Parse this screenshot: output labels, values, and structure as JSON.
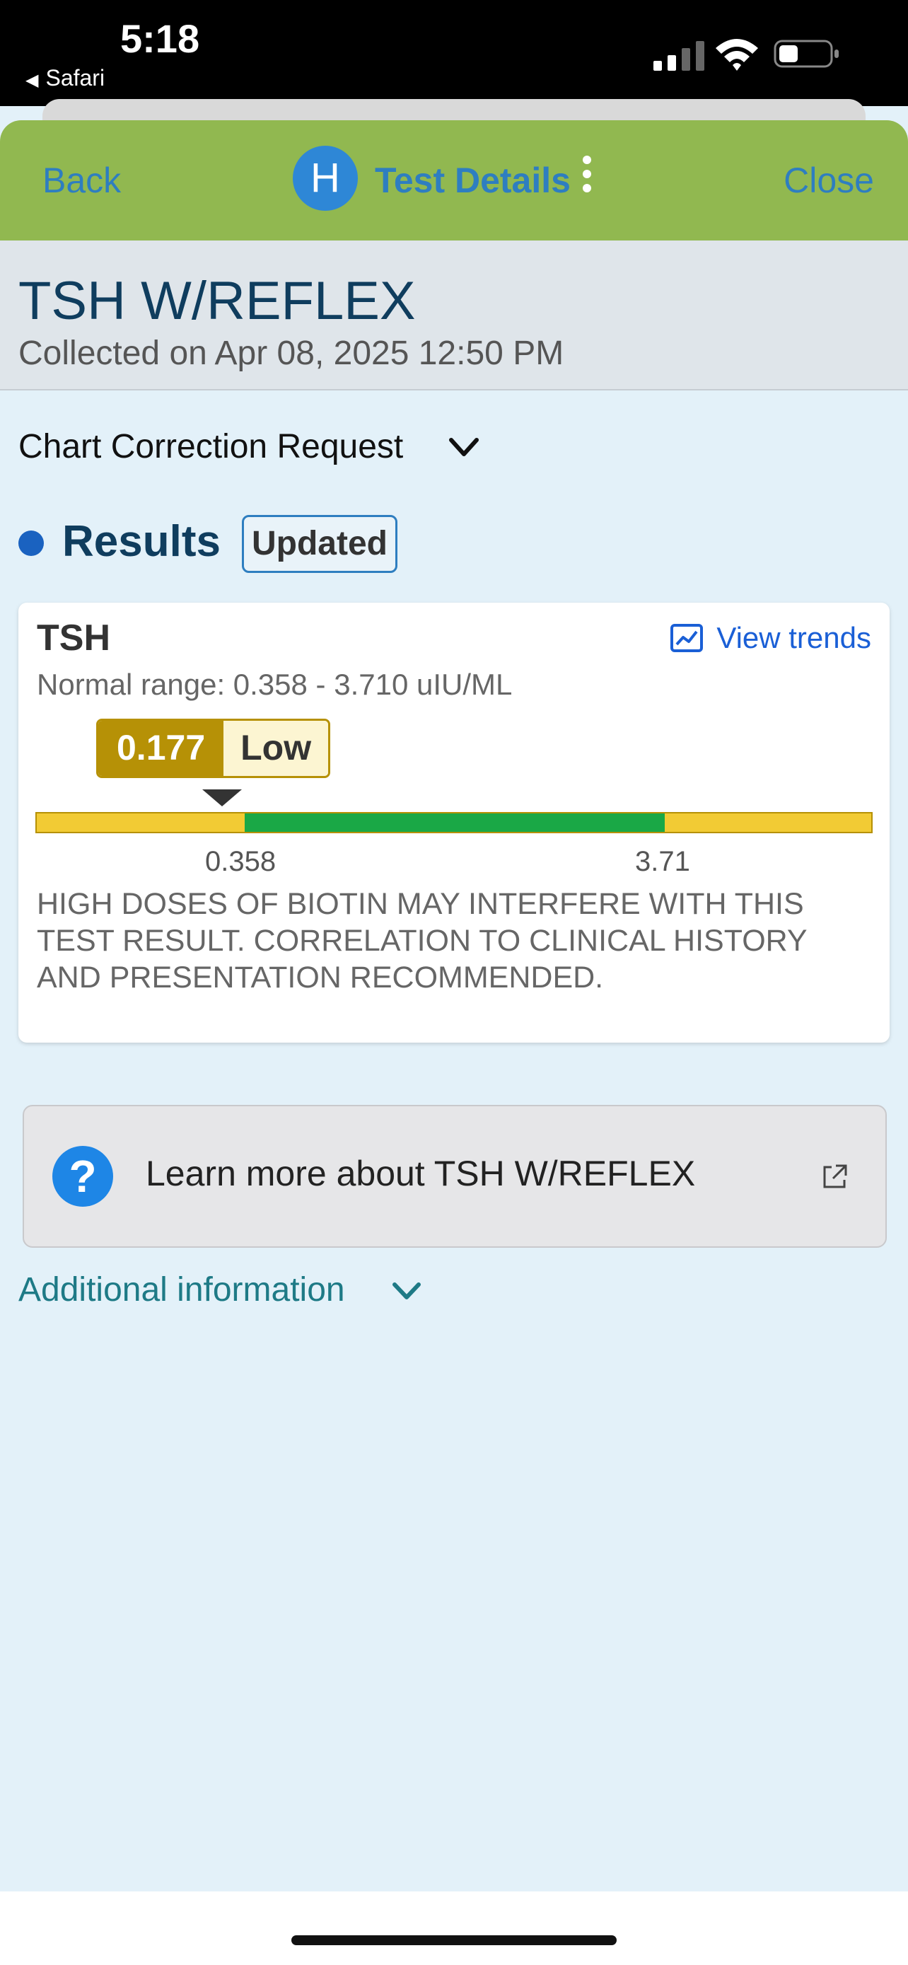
{
  "status": {
    "time": "5:18",
    "back_app": "Safari",
    "back_arrow": "◀"
  },
  "nav": {
    "back_label": "Back",
    "avatar_letter": "H",
    "title": "Test Details",
    "close_label": "Close"
  },
  "header": {
    "title": "TSH W/REFLEX",
    "collected": "Collected on Apr 08, 2025 12:50 PM"
  },
  "chart_correction": {
    "label": "Chart Correction Request"
  },
  "results": {
    "title": "Results",
    "badge": "Updated"
  },
  "result_card": {
    "test_name": "TSH",
    "view_trends": "View trends",
    "normal_range": "Normal range: 0.358 - 3.710 uIU/ML",
    "value": "0.177",
    "flag": "Low",
    "range_low_label": "0.358",
    "range_high_label": "3.71",
    "comment": "HIGH DOSES OF BIOTIN MAY INTERFERE WITH THIS TEST RESULT. CORRELATION TO CLINICAL HISTORY AND PRESENTATION RECOMMENDED."
  },
  "learn_more": {
    "icon": "?",
    "label": "Learn more about TSH W/REFLEX"
  },
  "additional": {
    "label": "Additional information"
  },
  "colors": {
    "nav_bg": "#91b850",
    "link_blue": "#2e7ec0",
    "low_flag": "#b69106",
    "normal_green": "#1aa846",
    "out_of_range_yellow": "#f2cb34"
  }
}
